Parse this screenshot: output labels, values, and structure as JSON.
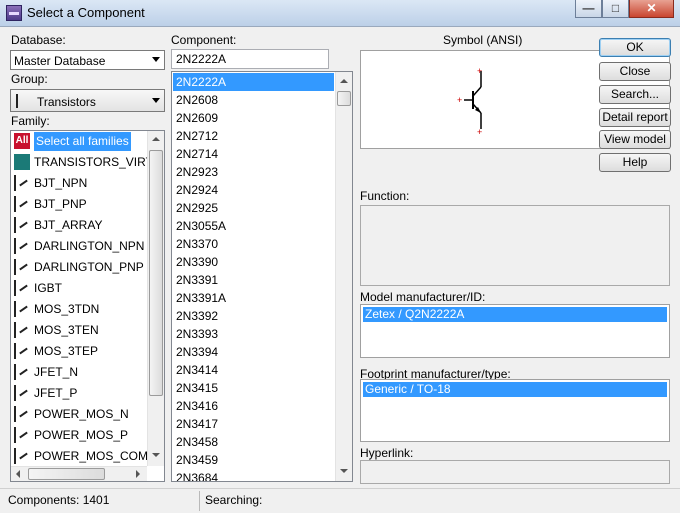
{
  "window": {
    "title": "Select a Component",
    "controls": [
      "minimize-icon",
      "maximize-icon",
      "close-icon"
    ]
  },
  "database": {
    "label": "Database:",
    "value": "Master Database"
  },
  "group": {
    "label": "Group:",
    "value": "Transistors",
    "icon": "transistor-icon"
  },
  "family": {
    "label": "Family:",
    "items": [
      {
        "label": "Select all families",
        "icon": "all-families-icon",
        "selected": true
      },
      {
        "label": "TRANSISTORS_VIRTUAL",
        "icon": "virtual-transistor-icon"
      },
      {
        "label": "BJT_NPN",
        "icon": "npn-icon"
      },
      {
        "label": "BJT_PNP",
        "icon": "pnp-icon"
      },
      {
        "label": "BJT_ARRAY",
        "icon": "bjt-array-icon"
      },
      {
        "label": "DARLINGTON_NPN",
        "icon": "darlington-npn-icon"
      },
      {
        "label": "DARLINGTON_PNP",
        "icon": "darlington-pnp-icon"
      },
      {
        "label": "IGBT",
        "icon": "igbt-icon"
      },
      {
        "label": "MOS_3TDN",
        "icon": "mosfet-icon"
      },
      {
        "label": "MOS_3TEN",
        "icon": "mosfet-icon"
      },
      {
        "label": "MOS_3TEP",
        "icon": "mosfet-icon"
      },
      {
        "label": "JFET_N",
        "icon": "jfet-icon"
      },
      {
        "label": "JFET_P",
        "icon": "jfet-icon"
      },
      {
        "label": "POWER_MOS_N",
        "icon": "power-mos-icon"
      },
      {
        "label": "POWER_MOS_P",
        "icon": "power-mos-icon"
      },
      {
        "label": "POWER_MOS_COMP",
        "icon": "power-mos-icon"
      }
    ]
  },
  "component": {
    "label": "Component:",
    "search_value": "2N2222A",
    "items": [
      "2N2222A",
      "2N2608",
      "2N2609",
      "2N2712",
      "2N2714",
      "2N2923",
      "2N2924",
      "2N2925",
      "2N3055A",
      "2N3370",
      "2N3390",
      "2N3391",
      "2N3391A",
      "2N3392",
      "2N3393",
      "2N3394",
      "2N3414",
      "2N3415",
      "2N3416",
      "2N3417",
      "2N3458",
      "2N3459",
      "2N3684"
    ],
    "selected_index": 0
  },
  "symbol": {
    "label": "Symbol (ANSI)"
  },
  "function": {
    "label": "Function:"
  },
  "model": {
    "label": "Model manufacturer/ID:",
    "value": "Zetex / Q2N2222A"
  },
  "footprint": {
    "label": "Footprint manufacturer/type:",
    "value": "Generic / TO-18"
  },
  "hyperlink": {
    "label": "Hyperlink:"
  },
  "buttons": {
    "ok": "OK",
    "close": "Close",
    "search": "Search...",
    "detail_report": "Detail report",
    "view_model": "View model",
    "help": "Help"
  },
  "status": {
    "components": "Components: 1401",
    "searching": "Searching:"
  },
  "colors": {
    "selection": "#3399ff",
    "symbol_red": "#cc0000"
  }
}
